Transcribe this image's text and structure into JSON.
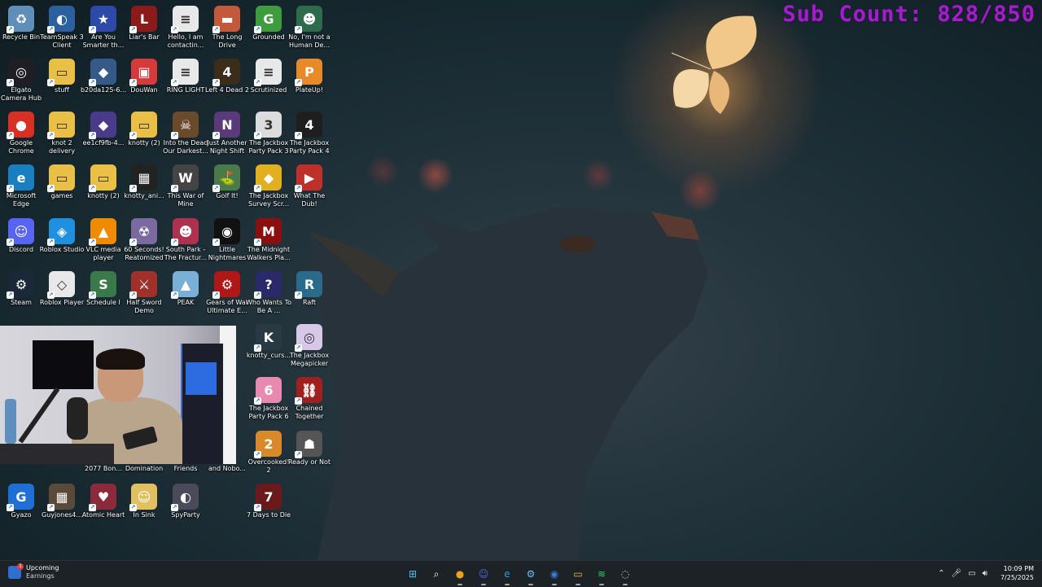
{
  "overlay": {
    "sub_count": "Sub Count: 828/850"
  },
  "desktop_icons": [
    {
      "label": "Recycle Bin",
      "icon": "recycle-bin-icon",
      "color": "#5f8fb8",
      "glyph": "♻"
    },
    {
      "label": "TeamSpeak 3 Client",
      "icon": "teamspeak-icon",
      "color": "#2c5f9e",
      "glyph": "◐"
    },
    {
      "label": "Are You Smarter th...",
      "icon": "game-icon",
      "color": "#2d4aa8",
      "glyph": "★"
    },
    {
      "label": "Liar's Bar",
      "icon": "game-icon",
      "color": "#8b1a1a",
      "glyph": "L"
    },
    {
      "label": "Hello, I am contactin...",
      "icon": "text-file-icon",
      "color": "#e8e8e8",
      "glyph": "≡"
    },
    {
      "label": "The Long Drive",
      "icon": "game-icon",
      "color": "#c4583a",
      "glyph": "▬"
    },
    {
      "label": "Grounded",
      "icon": "game-icon",
      "color": "#3e9b3e",
      "glyph": "G"
    },
    {
      "label": "No, I'm not a Human De...",
      "icon": "game-icon",
      "color": "#2e6b4a",
      "glyph": "☻"
    },
    {
      "label": "Elgato Camera Hub",
      "icon": "camera-icon",
      "color": "#1e1e24",
      "glyph": "◎"
    },
    {
      "label": "stuff",
      "icon": "folder-icon",
      "color": "#e9c045",
      "glyph": "▭"
    },
    {
      "label": "b20da125-6...",
      "icon": "app-icon",
      "color": "#355a8a",
      "glyph": "◆"
    },
    {
      "label": "DouWan",
      "icon": "app-icon",
      "color": "#d63a3a",
      "glyph": "▣"
    },
    {
      "label": "RING LIGHT",
      "icon": "text-file-icon",
      "color": "#e8e8e8",
      "glyph": "≡"
    },
    {
      "label": "Left 4 Dead 2",
      "icon": "game-icon",
      "color": "#3b2d1a",
      "glyph": "4"
    },
    {
      "label": "Scrutinized",
      "icon": "text-file-icon",
      "color": "#e8e8e8",
      "glyph": "≡"
    },
    {
      "label": "PlateUp!",
      "icon": "game-icon",
      "color": "#e98a2a",
      "glyph": "P"
    },
    {
      "label": "Google Chrome",
      "icon": "chrome-icon",
      "color": "#d93025",
      "glyph": "●"
    },
    {
      "label": "knot 2 delivery",
      "icon": "folder-icon",
      "color": "#e9c045",
      "glyph": "▭"
    },
    {
      "label": "ee1cf9fb-4...",
      "icon": "app-icon",
      "color": "#4a3a8a",
      "glyph": "◆"
    },
    {
      "label": "knotty (2)",
      "icon": "folder-icon",
      "color": "#e9c045",
      "glyph": "▭"
    },
    {
      "label": "Into the Dead Our Darkest...",
      "icon": "game-icon",
      "color": "#6a4a2a",
      "glyph": "☠"
    },
    {
      "label": "Just Another Night Shift",
      "icon": "game-icon",
      "color": "#5a3a7a",
      "glyph": "N"
    },
    {
      "label": "The Jackbox Party Pack 3",
      "icon": "game-icon",
      "color": "#dcdcdc",
      "glyph": "3"
    },
    {
      "label": "The Jackbox Party Pack 4",
      "icon": "game-icon",
      "color": "#1e1e1e",
      "glyph": "4"
    },
    {
      "label": "Microsoft Edge",
      "icon": "edge-icon",
      "color": "#1a7fc1",
      "glyph": "e"
    },
    {
      "label": "games",
      "icon": "folder-icon",
      "color": "#e9c045",
      "glyph": "▭"
    },
    {
      "label": "knotty (2)",
      "icon": "folder-icon",
      "color": "#e9c045",
      "glyph": "▭"
    },
    {
      "label": "knotty_ani...",
      "icon": "video-icon",
      "color": "#222222",
      "glyph": "▦"
    },
    {
      "label": "This War of Mine",
      "icon": "game-icon",
      "color": "#444444",
      "glyph": "W"
    },
    {
      "label": "Golf It!",
      "icon": "game-icon",
      "color": "#4a7a4a",
      "glyph": "⛳"
    },
    {
      "label": "The Jackbox Survey Scr...",
      "icon": "game-icon",
      "color": "#e0b020",
      "glyph": "◆"
    },
    {
      "label": "What The Dub!",
      "icon": "game-icon",
      "color": "#c0302a",
      "glyph": "▶"
    },
    {
      "label": "Discord",
      "icon": "discord-icon",
      "color": "#5865f2",
      "glyph": "☺"
    },
    {
      "label": "Roblox Studio",
      "icon": "roblox-studio-icon",
      "color": "#1f8fe0",
      "glyph": "◈"
    },
    {
      "label": "VLC media player",
      "icon": "vlc-icon",
      "color": "#f08a00",
      "glyph": "▲"
    },
    {
      "label": "60 Seconds! Reatomized",
      "icon": "game-icon",
      "color": "#7a6aa0",
      "glyph": "☢"
    },
    {
      "label": "South Park - The Fractur...",
      "icon": "game-icon",
      "color": "#b03050",
      "glyph": "☻"
    },
    {
      "label": "Little Nightmares",
      "icon": "game-icon",
      "color": "#111111",
      "glyph": "◉"
    },
    {
      "label": "The Midnight Walkers Pla...",
      "icon": "game-icon",
      "color": "#8a1010",
      "glyph": "M"
    },
    {
      "label": "",
      "icon": "",
      "color": "",
      "glyph": ""
    },
    {
      "label": "Steam",
      "icon": "steam-icon",
      "color": "#1b2838",
      "glyph": "⚙"
    },
    {
      "label": "Roblox Player",
      "icon": "roblox-icon",
      "color": "#e8e8e8",
      "glyph": "◇"
    },
    {
      "label": "Schedule I",
      "icon": "game-icon",
      "color": "#3a7a4a",
      "glyph": "S"
    },
    {
      "label": "Half Sword Demo",
      "icon": "game-icon",
      "color": "#a0302a",
      "glyph": "⚔"
    },
    {
      "label": "PEAK",
      "icon": "game-icon",
      "color": "#7ab0d8",
      "glyph": "▲"
    },
    {
      "label": "Gears of War Ultimate E...",
      "icon": "game-icon",
      "color": "#b01818",
      "glyph": "⚙"
    },
    {
      "label": "Who Wants To Be A ...",
      "icon": "game-icon",
      "color": "#2a2a6a",
      "glyph": "?"
    },
    {
      "label": "Raft",
      "icon": "game-icon",
      "color": "#2a6a8a",
      "glyph": "R"
    },
    {
      "label": "knotty_curs...",
      "icon": "app-icon",
      "color": "#2a3a44",
      "glyph": "K"
    },
    {
      "label": "The Jackbox Megapicker",
      "icon": "game-icon",
      "color": "#d8c8e8",
      "glyph": "◎"
    },
    {
      "label": "The Jackbox Party Pack 6",
      "icon": "game-icon",
      "color": "#e88ab0",
      "glyph": "6"
    },
    {
      "label": "Chained Together",
      "icon": "game-icon",
      "color": "#a02020",
      "glyph": "⛓"
    },
    {
      "label": "Overcooked! 2",
      "icon": "game-icon",
      "color": "#d88a2a",
      "glyph": "2"
    },
    {
      "label": "Ready or Not",
      "icon": "game-icon",
      "color": "#555555",
      "glyph": "☗"
    },
    {
      "label": "2077 Bon...",
      "icon": "game-icon",
      "color": "#333333",
      "glyph": ""
    },
    {
      "label": "Domination",
      "icon": "game-icon",
      "color": "#333333",
      "glyph": ""
    },
    {
      "label": "Friends",
      "icon": "game-icon",
      "color": "#333333",
      "glyph": ""
    },
    {
      "label": "and Nobo...",
      "icon": "game-icon",
      "color": "#333333",
      "glyph": ""
    },
    {
      "label": "Gyazo",
      "icon": "gyazo-icon",
      "color": "#1f6fd6",
      "glyph": "G"
    },
    {
      "label": "Guyjones4...",
      "icon": "app-icon",
      "color": "#5a4a3a",
      "glyph": "▦"
    },
    {
      "label": "Atomic Heart",
      "icon": "game-icon",
      "color": "#8a2a3a",
      "glyph": "♥"
    },
    {
      "label": "In Sink",
      "icon": "game-icon",
      "color": "#e0c060",
      "glyph": "☺"
    },
    {
      "label": "SpyParty",
      "icon": "game-icon",
      "color": "#4a4a5a",
      "glyph": "◐"
    },
    {
      "label": "7 Days to Die",
      "icon": "game-icon",
      "color": "#6a1a1a",
      "glyph": "7"
    }
  ],
  "taskbar": {
    "widget": {
      "title": "Upcoming",
      "subtitle": "Earnings",
      "badge": "1"
    },
    "clock": {
      "time": "10:09 PM",
      "date": "7/25/2025"
    },
    "apps": [
      {
        "name": "start-button",
        "glyph": "⊞",
        "color": "#4cc2ff"
      },
      {
        "name": "search-button",
        "glyph": "⌕",
        "color": "#ffffff"
      },
      {
        "name": "chrome-taskbar",
        "glyph": "●",
        "color": "#e8a020"
      },
      {
        "name": "discord-taskbar",
        "glyph": "☺",
        "color": "#5865f2"
      },
      {
        "name": "edge-taskbar",
        "glyph": "e",
        "color": "#2aa0d8"
      },
      {
        "name": "steam-taskbar",
        "glyph": "⚙",
        "color": "#66c0f4"
      },
      {
        "name": "ai-app-taskbar",
        "glyph": "◉",
        "color": "#3a7ad8"
      },
      {
        "name": "file-explorer-taskbar",
        "glyph": "▭",
        "color": "#f0c040"
      },
      {
        "name": "spotify-taskbar",
        "glyph": "≋",
        "color": "#1ed760"
      },
      {
        "name": "app-taskbar",
        "glyph": "◌",
        "color": "#cccccc"
      }
    ]
  }
}
